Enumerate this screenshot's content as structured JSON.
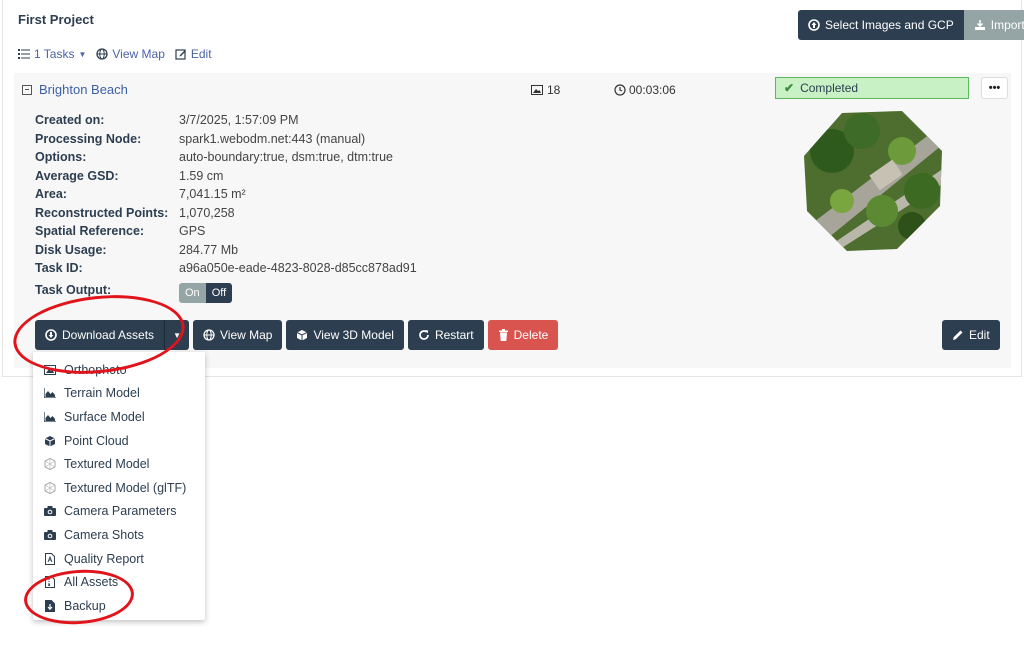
{
  "project": {
    "title": "First Project",
    "select_images_label": "Select Images and GCP",
    "import_label": "Import",
    "tasks_link": "1 Tasks",
    "view_map_link": "View Map",
    "edit_link": "Edit"
  },
  "task": {
    "name": "Brighton Beach",
    "image_count": "18",
    "duration": "00:03:06",
    "status": "Completed",
    "details": [
      {
        "label": "Created on:",
        "value": "3/7/2025, 1:57:09 PM"
      },
      {
        "label": "Processing Node:",
        "value": "spark1.webodm.net:443 (manual)"
      },
      {
        "label": "Options:",
        "value": "auto-boundary:true, dsm:true, dtm:true"
      },
      {
        "label": "Average GSD:",
        "value": "1.59 cm"
      },
      {
        "label": "Area:",
        "value": "7,041.15 m²"
      },
      {
        "label": "Reconstructed Points:",
        "value": "1,070,258"
      },
      {
        "label": "Spatial Reference:",
        "value": "GPS"
      },
      {
        "label": "Disk Usage:",
        "value": "284.77 Mb"
      },
      {
        "label": "Task ID:",
        "value": "a96a050e-eade-4823-8028-d85cc878ad91"
      }
    ],
    "output_label": "Task Output:",
    "toggle_on": "On",
    "toggle_off": "Off",
    "actions": {
      "download_assets": "Download Assets",
      "view_map": "View Map",
      "view_3d": "View 3D Model",
      "restart": "Restart",
      "delete": "Delete",
      "edit": "Edit"
    }
  },
  "dropdown": [
    {
      "label": "Orthophoto",
      "icon": "image-icon"
    },
    {
      "label": "Terrain Model",
      "icon": "area-chart-icon"
    },
    {
      "label": "Surface Model",
      "icon": "area-chart-icon"
    },
    {
      "label": "Point Cloud",
      "icon": "cube-icon"
    },
    {
      "label": "Textured Model",
      "icon": "textured-model-icon"
    },
    {
      "label": "Textured Model (glTF)",
      "icon": "textured-model-icon"
    },
    {
      "label": "Camera Parameters",
      "icon": "camera-icon"
    },
    {
      "label": "Camera Shots",
      "icon": "camera-icon"
    },
    {
      "label": "Quality Report",
      "icon": "pdf-file-icon"
    },
    {
      "label": "All Assets",
      "icon": "zip-file-icon"
    },
    {
      "label": "Backup",
      "icon": "download-file-icon"
    }
  ],
  "colors": {
    "dark_button": "#2c3e50",
    "grey_button": "#95a5a6",
    "delete_button": "#d9534f",
    "status_bg": "#c8f2c5",
    "annotation_red": "#e0141a"
  }
}
